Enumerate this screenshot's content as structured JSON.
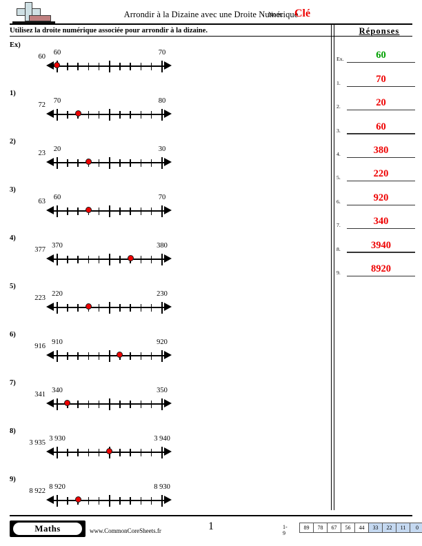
{
  "header": {
    "logo_name": "commoncoresheets-logo",
    "title": "Arrondir à la Dizaine avec une Droite Numérique",
    "name_label": "Nom:",
    "name_value": "Clé"
  },
  "instructions": "Utilisez la droite numérique associée pour arrondir à la dizaine.",
  "answers_heading": "Réponses",
  "problems": [
    {
      "number": "Ex)",
      "value": "60",
      "start_label": "60",
      "end_label": "70",
      "dot_index": 0
    },
    {
      "number": "1)",
      "value": "72",
      "start_label": "70",
      "end_label": "80",
      "dot_index": 2
    },
    {
      "number": "2)",
      "value": "23",
      "start_label": "20",
      "end_label": "30",
      "dot_index": 3
    },
    {
      "number": "3)",
      "value": "63",
      "start_label": "60",
      "end_label": "70",
      "dot_index": 3
    },
    {
      "number": "4)",
      "value": "377",
      "start_label": "370",
      "end_label": "380",
      "dot_index": 7
    },
    {
      "number": "5)",
      "value": "223",
      "start_label": "220",
      "end_label": "230",
      "dot_index": 3
    },
    {
      "number": "6)",
      "value": "916",
      "start_label": "910",
      "end_label": "920",
      "dot_index": 6
    },
    {
      "number": "7)",
      "value": "341",
      "start_label": "340",
      "end_label": "350",
      "dot_index": 1
    },
    {
      "number": "8)",
      "value": "3 935",
      "start_label": "3 930",
      "end_label": "3 940",
      "dot_index": 5
    },
    {
      "number": "9)",
      "value": "8 922",
      "start_label": "8 920",
      "end_label": "8 930",
      "dot_index": 2
    }
  ],
  "answers": [
    {
      "label": "Ex.",
      "value": "60",
      "color": "#00a000"
    },
    {
      "label": "1.",
      "value": "70",
      "color": "#ee0000"
    },
    {
      "label": "2.",
      "value": "20",
      "color": "#ee0000"
    },
    {
      "label": "3.",
      "value": "60",
      "color": "#ee0000"
    },
    {
      "label": "4.",
      "value": "380",
      "color": "#ee0000"
    },
    {
      "label": "5.",
      "value": "220",
      "color": "#ee0000"
    },
    {
      "label": "6.",
      "value": "920",
      "color": "#ee0000"
    },
    {
      "label": "7.",
      "value": "340",
      "color": "#ee0000"
    },
    {
      "label": "8.",
      "value": "3940",
      "color": "#ee0000"
    },
    {
      "label": "9.",
      "value": "8920",
      "color": "#ee0000"
    }
  ],
  "footer": {
    "badge": "Maths",
    "url": "www.CommonCoreSheets.fr",
    "page_number": "1",
    "scale_label": "1-9",
    "scale_cells": [
      {
        "value": "89",
        "highlighted": false
      },
      {
        "value": "78",
        "highlighted": false
      },
      {
        "value": "67",
        "highlighted": false
      },
      {
        "value": "56",
        "highlighted": false
      },
      {
        "value": "44",
        "highlighted": false
      },
      {
        "value": "33",
        "highlighted": true
      },
      {
        "value": "22",
        "highlighted": true
      },
      {
        "value": "11",
        "highlighted": true
      },
      {
        "value": "0",
        "highlighted": true
      }
    ]
  }
}
